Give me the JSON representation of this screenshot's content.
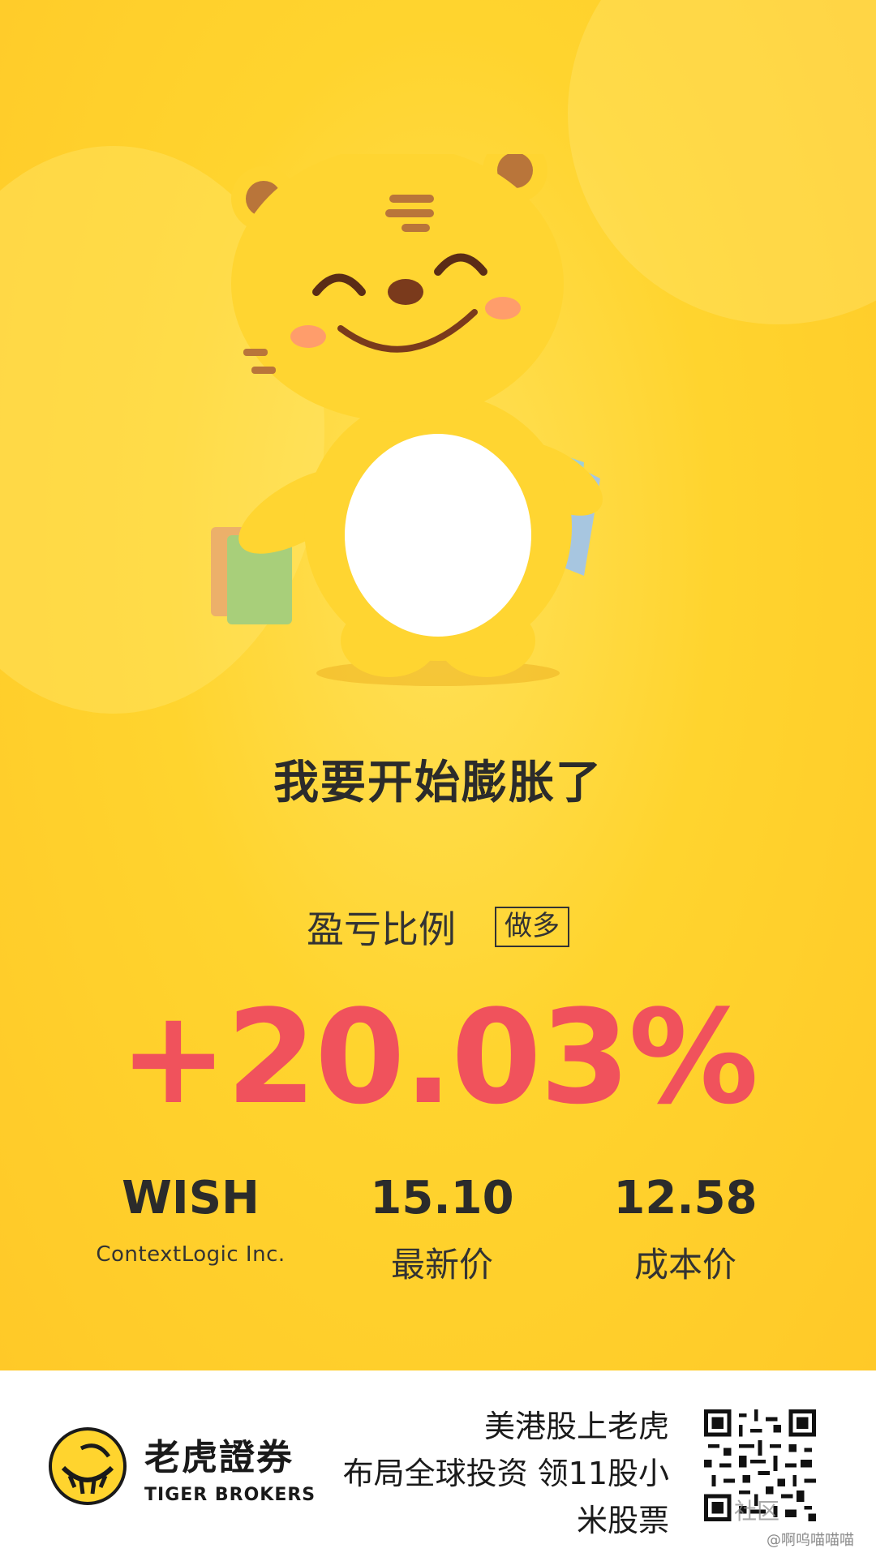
{
  "headline": "我要开始膨胀了",
  "profit": {
    "label": "盈亏比例",
    "position_badge": "做多",
    "percent": "+20.03%"
  },
  "stock": {
    "ticker": "WISH",
    "company": "ContextLogic Inc.",
    "latest_price": "15.10",
    "latest_price_label": "最新价",
    "cost_price": "12.58",
    "cost_price_label": "成本价"
  },
  "footer": {
    "brand_cn": "老虎證券",
    "brand_en": "TIGER BROKERS",
    "slogan_lines": [
      "美港股上老虎",
      "布局全球投资 领11股小",
      "米股票"
    ],
    "watermark": "社区",
    "credit": "@啊呜喵喵喵"
  },
  "colors": {
    "background": "#ffd42e",
    "percent": "#f0525c",
    "text_dark": "#2b2b2b"
  },
  "icons": [
    "tiger-mascot-illustration",
    "tiger-brokers-logo-icon",
    "qr-code-icon"
  ]
}
